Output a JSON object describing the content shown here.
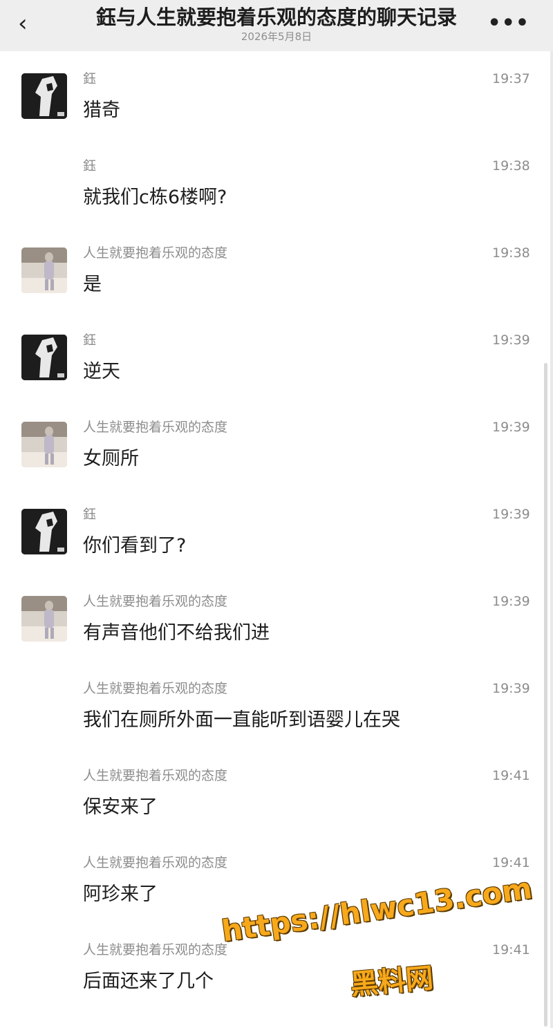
{
  "header": {
    "title": "鈺与人生就要抱着乐观的态度的聊天记录",
    "date": "2026年5月8日",
    "back_icon": "chevron-left-icon",
    "more_icon": "more-dots-icon",
    "more_glyph": "•••",
    "back_glyph": "‹"
  },
  "messages": [
    {
      "sender": "鈺",
      "time": "19:37",
      "text": "猎奇",
      "avatar": "dark"
    },
    {
      "sender": "鈺",
      "time": "19:38",
      "text": "就我们c栋6楼啊?",
      "avatar": "none"
    },
    {
      "sender": "人生就要抱着乐观的态度",
      "time": "19:38",
      "text": "是",
      "avatar": "light"
    },
    {
      "sender": "鈺",
      "time": "19:39",
      "text": "逆天",
      "avatar": "dark"
    },
    {
      "sender": "人生就要抱着乐观的态度",
      "time": "19:39",
      "text": "女厕所",
      "avatar": "light"
    },
    {
      "sender": "鈺",
      "time": "19:39",
      "text": "你们看到了?",
      "avatar": "dark"
    },
    {
      "sender": "人生就要抱着乐观的态度",
      "time": "19:39",
      "text": "有声音他们不给我们进",
      "avatar": "light"
    },
    {
      "sender": "人生就要抱着乐观的态度",
      "time": "19:39",
      "text": "我们在厕所外面一直能听到语婴儿在哭",
      "avatar": "none"
    },
    {
      "sender": "人生就要抱着乐观的态度",
      "time": "19:41",
      "text": "保安来了",
      "avatar": "none"
    },
    {
      "sender": "人生就要抱着乐观的态度",
      "time": "19:41",
      "text": "阿珍来了",
      "avatar": "none"
    },
    {
      "sender": "人生就要抱着乐观的态度",
      "time": "19:41",
      "text": "后面还来了几个",
      "avatar": "none"
    }
  ],
  "watermark": {
    "url": "https://hlwc13.com",
    "label": "黑料网"
  }
}
